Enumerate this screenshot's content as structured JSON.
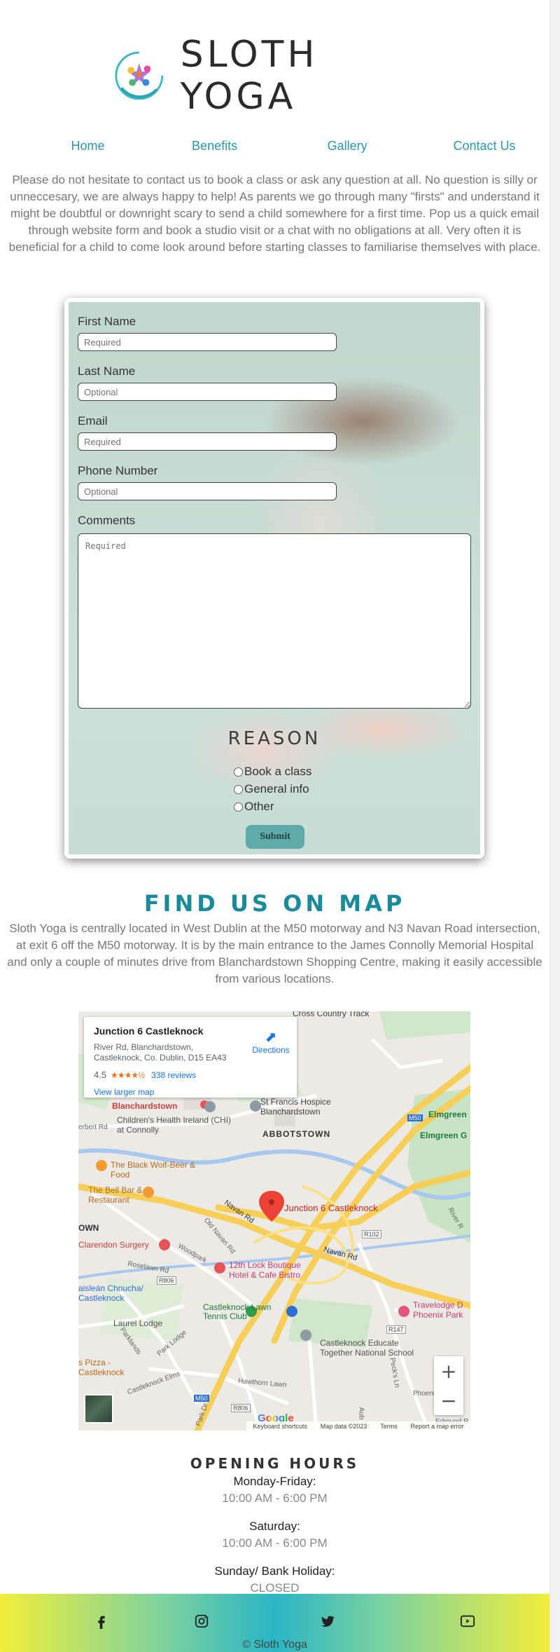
{
  "brand": {
    "name": "SLOTH YOGA"
  },
  "nav": {
    "items": [
      {
        "label": "Home"
      },
      {
        "label": "Benefits"
      },
      {
        "label": "Gallery"
      },
      {
        "label": "Contact Us"
      }
    ]
  },
  "intro": {
    "text": "Please do not hesitate to contact us to book a class or ask any question at all. No question is silly or unneccesary, we are always happy to help! As parents we go through many \"firsts\" and understand it might be doubtful or downright scary to send a child somewhere for a first time. Pop us a quick email through website form and book a studio visit or a chat with no obligations at all. Very often it is beneficial for a child to come look around before starting classes to familiarise themselves with place."
  },
  "form": {
    "first_name": {
      "label": "First Name",
      "placeholder": "Required"
    },
    "last_name": {
      "label": "Last Name",
      "placeholder": "Optional"
    },
    "email": {
      "label": "Email",
      "placeholder": "Required"
    },
    "phone": {
      "label": "Phone Number",
      "placeholder": "Optional"
    },
    "comments": {
      "label": "Comments",
      "placeholder": "Required"
    },
    "reason_title": "REASON",
    "reasons": [
      {
        "label": "Book a class"
      },
      {
        "label": "General info"
      },
      {
        "label": "Other"
      }
    ],
    "submit_label": "Submit"
  },
  "find_us": {
    "title": "FIND US ON MAP",
    "text": "Sloth Yoga is centrally located in West Dublin at the M50 motorway and N3 Navan Road intersection, at exit 6 off the M50 motorway. It is by the main entrance to the James Connolly Memorial Hospital and only a couple of minutes drive from Blanchardstown Shopping Centre, making it easily accessible from various locations."
  },
  "map": {
    "place_name": "Junction 6 Castleknock",
    "address": "River Rd, Blanchardstown, Castleknock, Co. Dublin, D15 EA43",
    "rating": "4.5",
    "stars": "★★★★½",
    "reviews": "338 reviews",
    "larger_map": "View larger map",
    "directions": "Directions",
    "pin_label": "Junction 6 Castleknock",
    "zoom_in": "+",
    "zoom_out": "−",
    "google": "Google",
    "footer": {
      "shortcuts": "Keyboard shortcuts",
      "data": "Map data ©2023",
      "terms": "Terms",
      "report": "Report a map error"
    },
    "labels": {
      "cross_country": "Cross Country Track",
      "st_francis": "St Francis Hospice Blanchardstown",
      "blanchardstown": "Blanchardstown",
      "childrens_health": "Children's Health Ireland (CHI) at Connolly",
      "abbotstown": "ABBOTSTOWN",
      "elmgreen": "Elmgreen",
      "elmgreen_g": "Elmgreen G",
      "black_wolf": "The Black Wolf-Beer & Food",
      "bell_bar": "The Bell Bar & Restaurant",
      "town": "OWN",
      "clarendon": "Clarendon Surgery",
      "twelfth_lock": "12th Lock Boutique Hotel & Cafe Bistro",
      "castleknock_lawn": "Castleknock Lawn Tennis Club",
      "gaisclean": "aisleán Chnucha/ Castleknock",
      "laurel": "Laurel Lodge",
      "castleknock_educate": "Castleknock Educate Together National School",
      "travelodge": "Travelodge D Phoenix Park",
      "pizza": "s Pizza - Castleknock",
      "navan_rd": "Navan Rd",
      "navan_rd2": "Navan Rd",
      "old_navan": "Old Navan Rd",
      "woodpark": "Woodpark",
      "roselawn": "Roselawn Rd",
      "herbert": "erbert Rd",
      "r806": "R806",
      "r102": "R102",
      "r147": "R147",
      "m50": "M50",
      "m50b": "M50",
      "parklands": "Parklands",
      "park_lodge": "Park Lodge",
      "castleknock_elms": "Castleknock Elms",
      "hawthorn": "Hawthorn Lawn",
      "peck": "Peck's Ln",
      "phoenix": "Phoenix",
      "river": "River R",
      "edmund": "Edmund R",
      "park_dr": "Park Dr",
      "r806b": "R806",
      "auburn": "Aub"
    }
  },
  "hours": {
    "title": "OPENING HOURS",
    "rows": [
      {
        "day": "Monday-Friday:",
        "time": "10:00 AM - 6:00 PM"
      },
      {
        "day": "Saturday:",
        "time": "10:00 AM - 6:00 PM"
      },
      {
        "day": "Sunday/ Bank Holiday:",
        "time": "CLOSED"
      }
    ]
  },
  "footer": {
    "copyright": "© Sloth Yoga",
    "icons": [
      "facebook-icon",
      "instagram-icon",
      "twitter-icon",
      "youtube-icon"
    ]
  }
}
